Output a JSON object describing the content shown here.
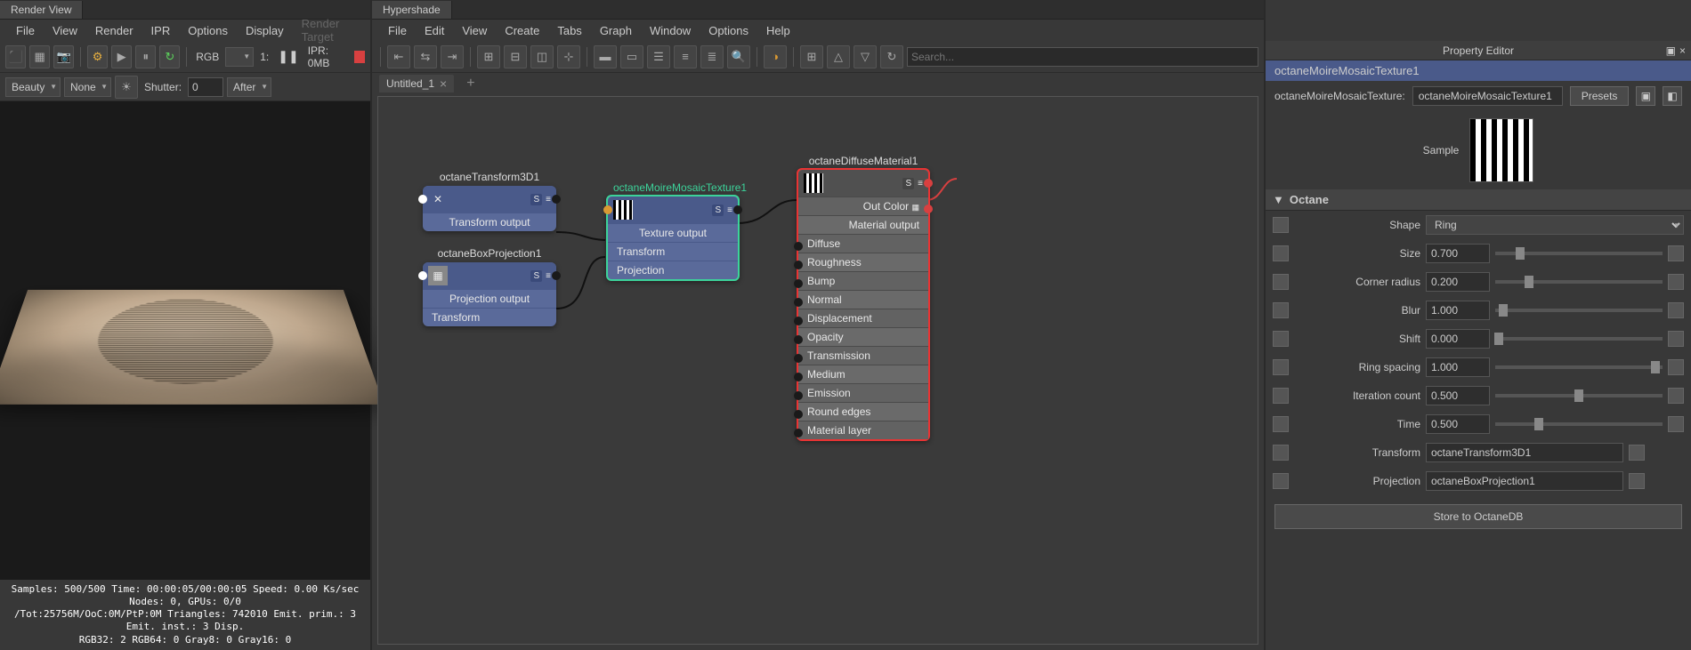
{
  "left_pane": {
    "tab_title": "Render View",
    "menu": [
      "File",
      "View",
      "Render",
      "IPR",
      "Options",
      "Display",
      "Render Target"
    ],
    "toolbar": {
      "rgb_label": "RGB",
      "frame_value": "1:",
      "ipr_label": "IPR: 0MB"
    },
    "second_toolbar": {
      "beauty": "Beauty",
      "none": "None",
      "shutter_label": "Shutter:",
      "shutter_value": "0",
      "after": "After"
    },
    "stats": [
      "Samples: 500/500 Time: 00:00:05/00:00:05 Speed: 0.00 Ks/sec",
      "Nodes: 0, GPUs: 0/0",
      "/Tot:25756M/OoC:0M/PtP:0M Triangles: 742010 Emit. prim.: 3 Emit. inst.: 3 Disp.",
      "RGB32: 2 RGB64: 0 Gray8: 0 Gray16: 0"
    ]
  },
  "center_pane": {
    "tab_title": "Hypershade",
    "menu": [
      "File",
      "Edit",
      "View",
      "Create",
      "Tabs",
      "Graph",
      "Window",
      "Options",
      "Help"
    ],
    "search_placeholder": "Search...",
    "graph_tab": "Untitled_1",
    "nodes": {
      "transform3d": {
        "title": "octaneTransform3D1",
        "output": "Transform output"
      },
      "box_projection": {
        "title": "octaneBoxProjection1",
        "output": "Projection output",
        "rows": [
          "Transform"
        ]
      },
      "moire": {
        "title": "octaneMoireMosaicTexture1",
        "output": "Texture output",
        "rows": [
          "Transform",
          "Projection"
        ]
      },
      "diffuse": {
        "title": "octaneDiffuseMaterial1",
        "out_color": "Out Color",
        "output": "Material output",
        "rows": [
          "Diffuse",
          "Roughness",
          "Bump",
          "Normal",
          "Displacement",
          "Opacity",
          "Transmission",
          "Medium",
          "Emission",
          "Round edges",
          "Material layer"
        ]
      }
    }
  },
  "right_pane": {
    "header": "Property Editor",
    "title": "octaneMoireMosaicTexture1",
    "label": "octaneMoireMosaicTexture:",
    "value": "octaneMoireMosaicTexture1",
    "presets": "Presets",
    "sample_label": "Sample",
    "section": "Octane",
    "params": {
      "shape": {
        "label": "Shape",
        "value": "Ring"
      },
      "size": {
        "label": "Size",
        "value": "0.700",
        "pct": 15
      },
      "corner_radius": {
        "label": "Corner radius",
        "value": "0.200",
        "pct": 20
      },
      "blur": {
        "label": "Blur",
        "value": "1.000",
        "pct": 5
      },
      "shift": {
        "label": "Shift",
        "value": "0.000",
        "pct": 2
      },
      "ring_spacing": {
        "label": "Ring spacing",
        "value": "1.000",
        "pct": 96
      },
      "iteration_count": {
        "label": "Iteration count",
        "value": "0.500",
        "pct": 50
      },
      "time": {
        "label": "Time",
        "value": "0.500",
        "pct": 26
      },
      "transform": {
        "label": "Transform",
        "value": "octaneTransform3D1"
      },
      "projection": {
        "label": "Projection",
        "value": "octaneBoxProjection1"
      }
    },
    "store_label": "Store to OctaneDB"
  }
}
